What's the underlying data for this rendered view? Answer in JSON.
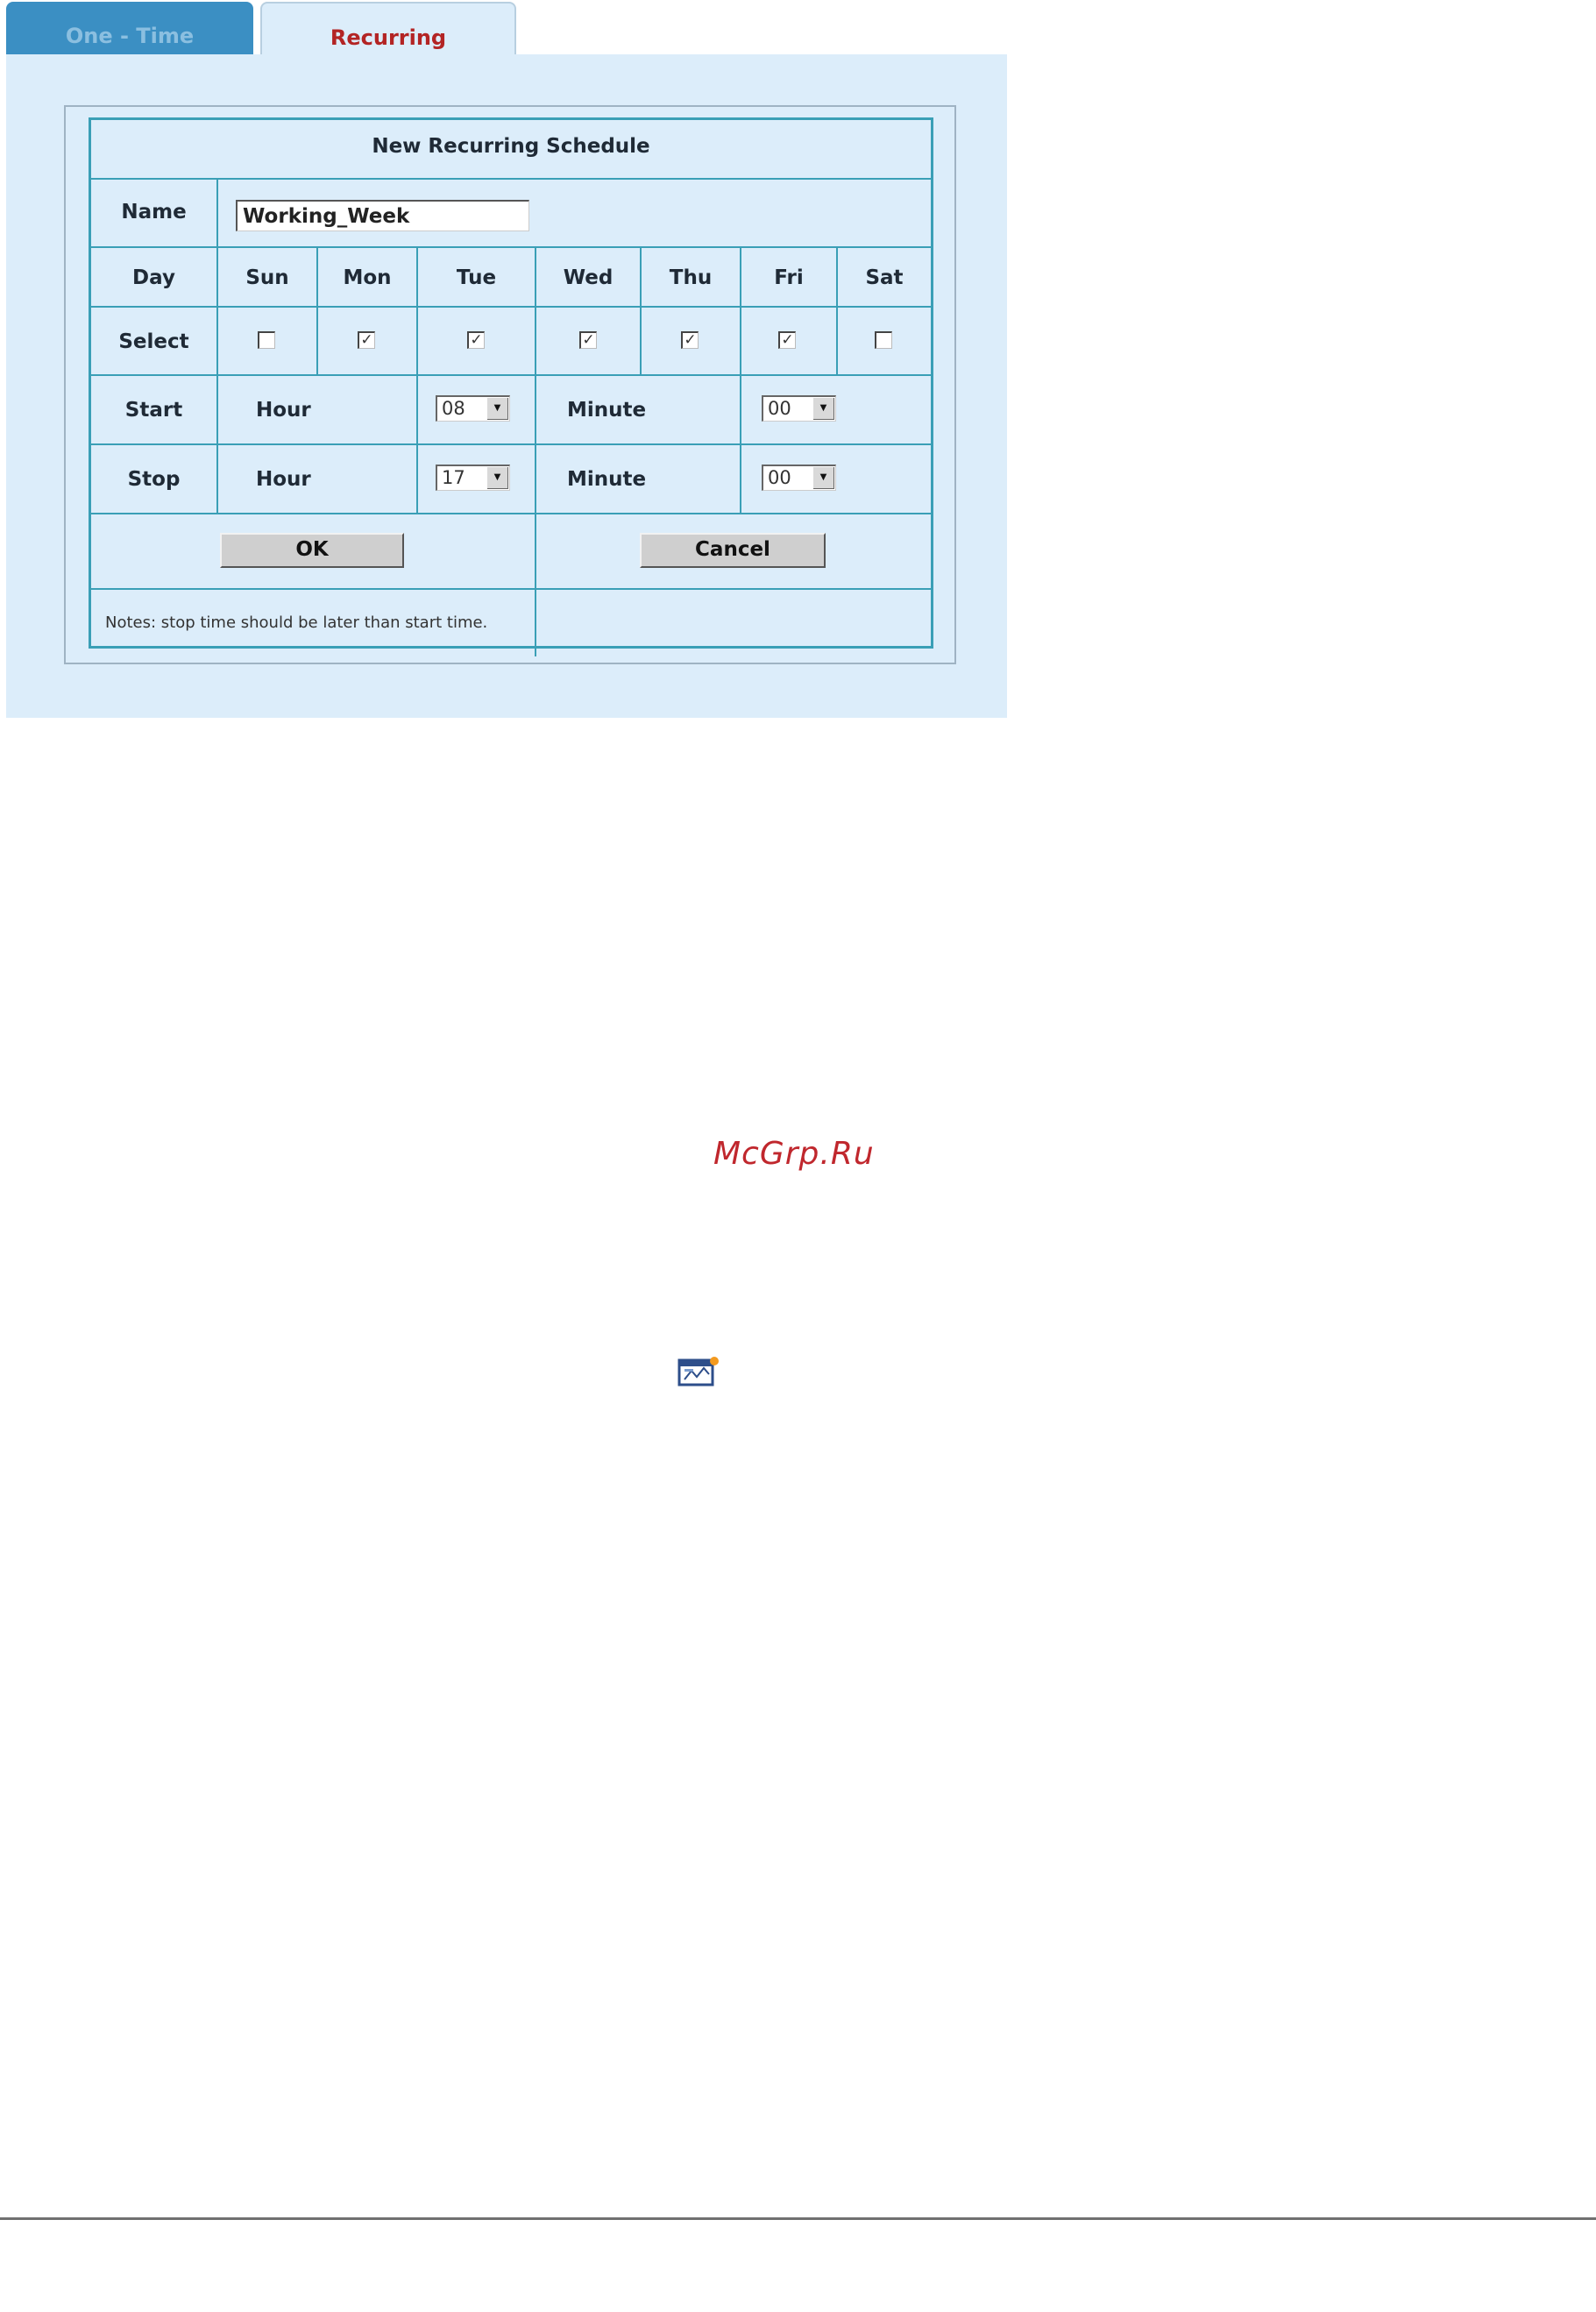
{
  "tabs": [
    {
      "label": "One - Time",
      "active": false
    },
    {
      "label": "Recurring",
      "active": true
    }
  ],
  "form": {
    "title": "New Recurring Schedule",
    "name_label": "Name",
    "name_value": "Working_Week",
    "day_label": "Day",
    "select_label": "Select",
    "days": [
      {
        "label": "Sun",
        "checked": false
      },
      {
        "label": "Mon",
        "checked": true
      },
      {
        "label": "Tue",
        "checked": true
      },
      {
        "label": "Wed",
        "checked": true
      },
      {
        "label": "Thu",
        "checked": true
      },
      {
        "label": "Fri",
        "checked": true
      },
      {
        "label": "Sat",
        "checked": false
      }
    ],
    "start": {
      "label": "Start",
      "hour_label": "Hour",
      "hour_value": "08",
      "minute_label": "Minute",
      "minute_value": "00"
    },
    "stop": {
      "label": "Stop",
      "hour_label": "Hour",
      "hour_value": "17",
      "minute_label": "Minute",
      "minute_value": "00"
    },
    "ok_label": "OK",
    "cancel_label": "Cancel",
    "notes": "Notes: stop time should be later than start time."
  },
  "watermark": "McGrp.Ru",
  "icons": {
    "document": "document-edit-icon",
    "dropdown": "dropdown-arrow-icon"
  },
  "colors": {
    "active_tab_text": "#b32424",
    "inactive_tab_bg": "#3b8fc3",
    "panel_bg": "#dcedfa",
    "grid_border": "#3a9fb6",
    "watermark": "#c0272d"
  }
}
